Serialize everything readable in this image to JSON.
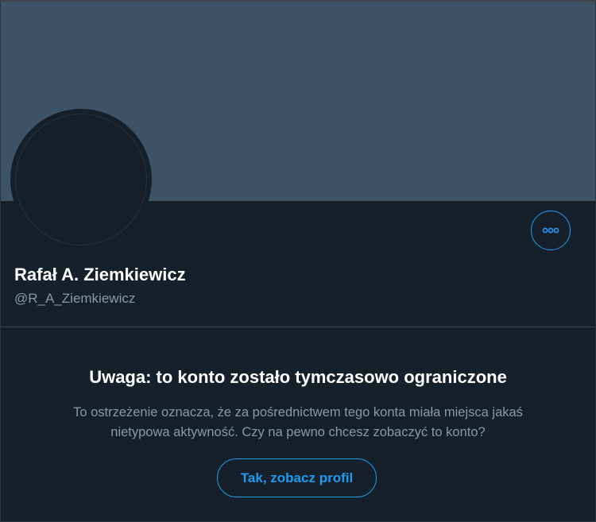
{
  "profile": {
    "name": "Rafał A. Ziemkiewicz",
    "handle": "@R_A_Ziemkiewicz"
  },
  "more_button": {
    "icon": "more-horizontal-icon"
  },
  "warning": {
    "title": "Uwaga: to konto zostało tymczasowo ograniczone",
    "line1": "To ostrzeżenie oznacza, że za pośrednictwem tego konta miała miejsca jakaś",
    "line2": "nietypowa aktywność. Czy na pewno chcesz zobaczyć to konto?",
    "button_label": "Tak, zobacz profil"
  },
  "colors": {
    "background": "#15202b",
    "banner": "#3d5466",
    "accent": "#1d9bf0",
    "secondary_text": "#8b98a5"
  }
}
